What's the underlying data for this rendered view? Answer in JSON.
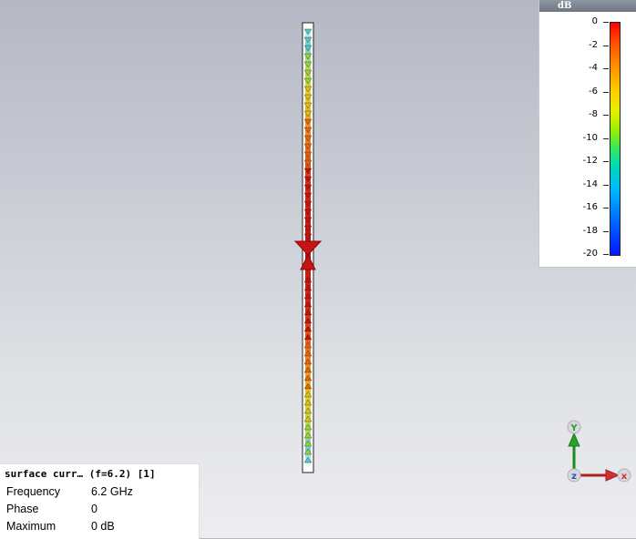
{
  "legend": {
    "unit": "dB",
    "ticks": [
      "0",
      "-2",
      "-4",
      "-6",
      "-8",
      "-10",
      "-12",
      "-14",
      "-16",
      "-18",
      "-20"
    ]
  },
  "axes": {
    "y_label": "Y",
    "z_label": "z",
    "x_label": "x",
    "y_color": "#2aa02a",
    "x_color": "#d03030",
    "z_color": "#3050c0"
  },
  "info": {
    "title": "surface curr… (f=6.2) [1]",
    "rows": [
      {
        "label": "Frequency",
        "value": "6.2 GHz"
      },
      {
        "label": "Phase",
        "value": "0"
      },
      {
        "label": "Maximum",
        "value": "0 dB"
      }
    ]
  },
  "view": {
    "colormap": "rainbow",
    "max_color": "#e01010"
  }
}
